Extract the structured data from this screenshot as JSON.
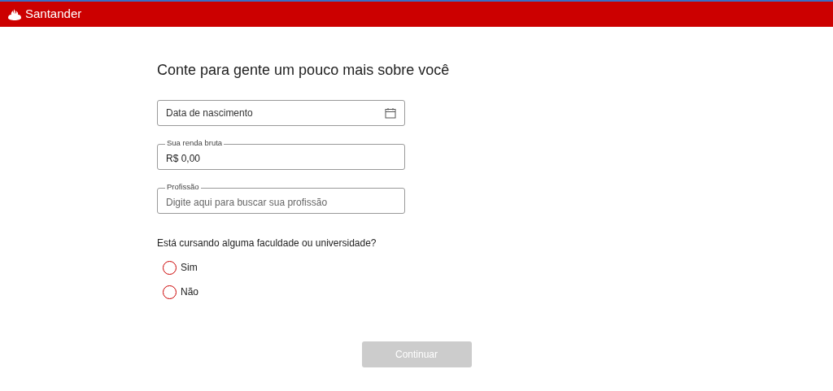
{
  "header": {
    "brand": "Santander"
  },
  "title": "Conte para gente um pouco mais sobre você",
  "fields": [
    {
      "kind": "date",
      "placeholder": "Data de nascimento"
    },
    {
      "kind": "text",
      "label": "Sua renda bruta",
      "value": "R$ 0,00"
    },
    {
      "kind": "text",
      "label": "Profissão",
      "placeholder": "Digite aqui para buscar sua profissão"
    }
  ],
  "question": "Está cursando alguma faculdade ou universidade?",
  "options": [
    {
      "label": "Sim",
      "selected": false
    },
    {
      "label": "Não",
      "selected": false
    }
  ],
  "submit": {
    "label": "Continuar",
    "disabled": true
  }
}
